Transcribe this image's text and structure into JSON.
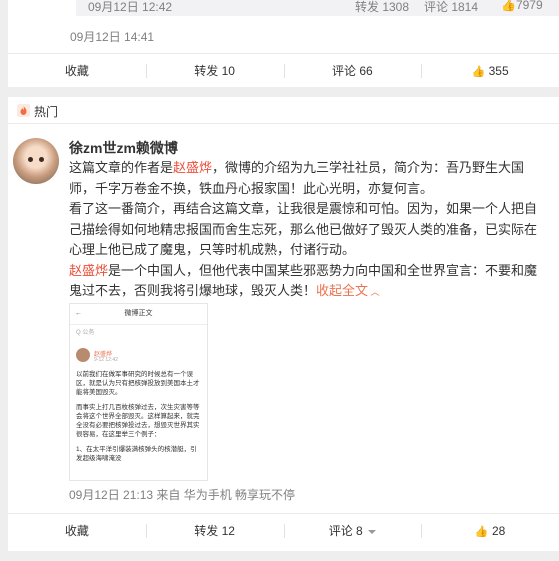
{
  "quoted_stats": {
    "time": "09月12日 12:42",
    "repost": "转发 1308",
    "comment": "评论 1814",
    "like": "7979"
  },
  "post1": {
    "time": "09月12日 14:41",
    "actions": {
      "fav": "收藏",
      "repost": "转发 10",
      "comment": "评论 66",
      "like": "355"
    }
  },
  "hot": {
    "label": "热门"
  },
  "post2": {
    "username": "徐zm世zm赖微博",
    "p1_a": "这篇文章的作者是",
    "name": "赵盛烨",
    "p1_b": "，微博的介绍为九三学社社员，简介为：吾乃野生大国师，千字万卷金不换，铁血丹心报家国！此心光明，亦复何言。",
    "p2": "看了这一番简介，再结合这篇文章，让我很是震惊和可怕。因为，如果一个人把自己描绘得如何地精忠报国而舍生忘死，那么他已做好了毁灭人类的准备，已实际在心理上他已成了魔鬼，只等时机成熟，付诸行动。",
    "p3_b": "是一个中国人，但他代表中国某些邪恶势力向中国和全世界宣言：不要和魔鬼过不去，否则我将引爆地球，毁灭人类！",
    "expand": "收起全文",
    "time_source": "09月12日 21:13 来自 华为手机 畅享玩不停",
    "actions": {
      "fav": "收藏",
      "repost": "转发 12",
      "comment": "评论 8",
      "like": "28"
    },
    "screenshot": {
      "nav_title": "微博正文",
      "back": "←",
      "hint": "Q 公务",
      "author": "赵盛烨",
      "date": "9-12 12:42",
      "para1": "以前我们在做军事研究的时候总有一个误区，就是认为只有把核弹投放到美国本土才能将美国毁灭。",
      "para2": "而事实上打几百枚核弹过去，次生灾害等等会将这个世界全部毁灭。这样算起来，就完全没有必要把核弹投过去，想毁灭世界其实很容易，在这里举三个例子：",
      "para3": "1、在太平洋引爆装满核弹头的核潜艇，引发超级海啸淹没"
    }
  }
}
